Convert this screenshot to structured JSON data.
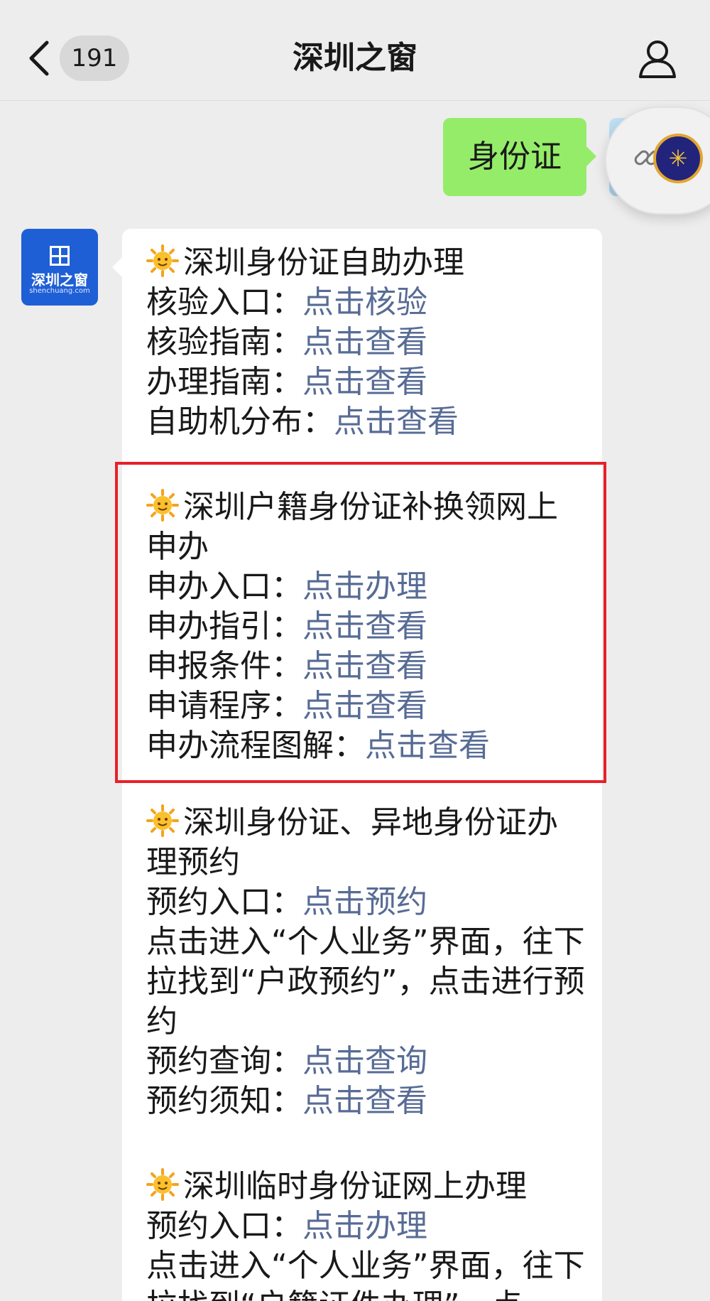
{
  "navbar": {
    "back_icon": "chevron-left-icon",
    "unread_count": "191",
    "title": "深圳之窗",
    "profile_icon": "person-icon"
  },
  "outgoing": {
    "text": "身份证"
  },
  "account_logo": {
    "name": "深圳之窗",
    "domain": "shenchuang.com"
  },
  "incoming": {
    "sections": [
      {
        "title": "深圳身份证自助办理",
        "rows": [
          {
            "label": "核验入口：",
            "link": "点击核验"
          },
          {
            "label": "核验指南：",
            "link": "点击查看"
          },
          {
            "label": "办理指南：",
            "link": "点击查看"
          },
          {
            "label": "自助机分布：",
            "link": "点击查看"
          }
        ]
      },
      {
        "title": "深圳户籍身份证补换领网上申办",
        "rows": [
          {
            "label": "申办入口：",
            "link": "点击办理"
          },
          {
            "label": "申办指引：",
            "link": "点击查看"
          },
          {
            "label": "申报条件：",
            "link": "点击查看"
          },
          {
            "label": "申请程序：",
            "link": "点击查看"
          },
          {
            "label": "申办流程图解：",
            "link": "点击查看"
          }
        ]
      },
      {
        "title": "深圳身份证、异地身份证办理预约",
        "entry": {
          "label": "预约入口：",
          "link": "点击预约"
        },
        "note": "点击进入“个人业务”界面，往下拉找到“户政预约”，点击进行预约",
        "rows": [
          {
            "label": "预约查询：",
            "link": "点击查询"
          },
          {
            "label": "预约须知：",
            "link": "点击查看"
          }
        ]
      },
      {
        "title": "深圳临时身份证网上办理",
        "entry": {
          "label": "预约入口：",
          "link": "点击办理"
        },
        "note": "点击进入“个人业务”界面，往下拉找到“户籍证件办理”，点"
      }
    ]
  },
  "colors": {
    "background": "#ededed",
    "outgoing_bubble": "#95ec69",
    "link": "#576b95",
    "highlight_border": "#e8202a",
    "logo_blue": "#1f5fd6"
  }
}
